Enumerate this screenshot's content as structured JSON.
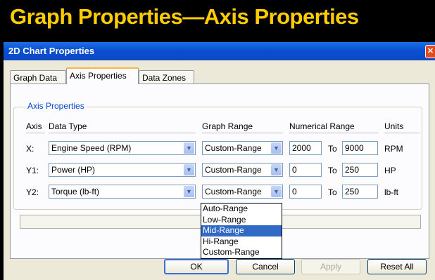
{
  "banner": {
    "title": "Graph Properties—Axis Properties"
  },
  "window": {
    "title": "2D Chart Properties",
    "close_icon": "close-icon"
  },
  "tabs": [
    {
      "label": "Graph Data"
    },
    {
      "label": "Axis Properties",
      "active": true
    },
    {
      "label": "Data Zones"
    }
  ],
  "axis_group": {
    "label": "Axis Properties",
    "headers": {
      "axis": "Axis",
      "data_type": "Data Type",
      "graph_range": "Graph Range",
      "numerical_range": "Numerical Range",
      "units": "Units"
    },
    "rows": [
      {
        "axis": "X:",
        "data_type": "Engine Speed (RPM)",
        "graph_range": "Custom-Range",
        "min": "2000",
        "to": "To",
        "max": "9000",
        "units": "RPM"
      },
      {
        "axis": "Y1:",
        "data_type": "Power (HP)",
        "graph_range": "Custom-Range",
        "min": "0",
        "to": "To",
        "max": "250",
        "units": "HP"
      },
      {
        "axis": "Y2:",
        "data_type": "Torque (lb-ft)",
        "graph_range": "Custom-Range",
        "min": "0",
        "to": "To",
        "max": "250",
        "units": "lb-ft"
      }
    ]
  },
  "range_dropdown": {
    "options": [
      "Auto-Range",
      "Low-Range",
      "Mid-Range",
      "Hi-Range",
      "Custom-Range"
    ],
    "highlighted": "Mid-Range"
  },
  "buttons": {
    "ok": "OK",
    "cancel": "Cancel",
    "apply": "Apply",
    "reset_all": "Reset All"
  },
  "colors": {
    "banner_text": "#ffcc00",
    "titlebar": "#0a4fd0",
    "group_label": "#0046d5",
    "highlight": "#316ac5"
  }
}
